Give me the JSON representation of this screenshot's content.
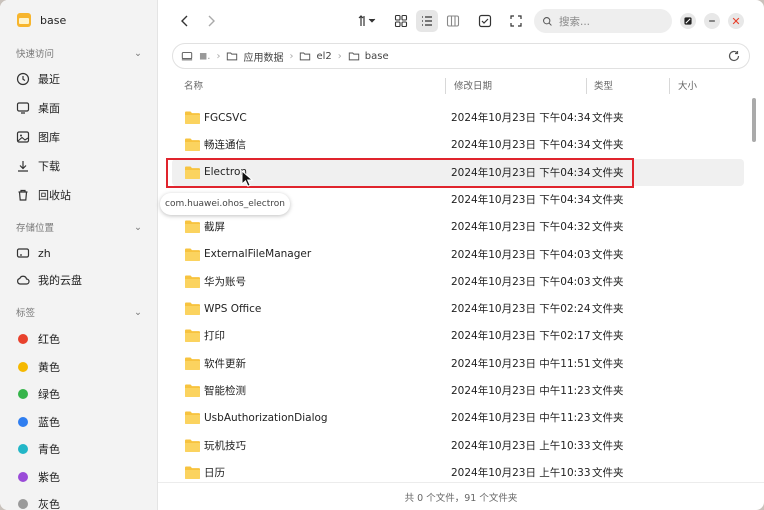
{
  "app": {
    "title": "base"
  },
  "sidebar": {
    "quick_access": {
      "header": "快速访问",
      "items": [
        {
          "label": "最近",
          "icon": "clock-icon"
        },
        {
          "label": "桌面",
          "icon": "desktop-icon"
        },
        {
          "label": "图库",
          "icon": "gallery-icon"
        },
        {
          "label": "下载",
          "icon": "download-icon"
        },
        {
          "label": "回收站",
          "icon": "trash-icon"
        }
      ]
    },
    "storage": {
      "header": "存储位置",
      "items": [
        {
          "label": "zh",
          "icon": "drive-icon"
        },
        {
          "label": "我的云盘",
          "icon": "cloud-icon"
        }
      ]
    },
    "tags": {
      "header": "标签",
      "items": [
        {
          "label": "红色",
          "color": "#e8412c"
        },
        {
          "label": "黄色",
          "color": "#f5b800"
        },
        {
          "label": "绿色",
          "color": "#35b44a"
        },
        {
          "label": "蓝色",
          "color": "#2f7ef0"
        },
        {
          "label": "青色",
          "color": "#22b6c7"
        },
        {
          "label": "紫色",
          "color": "#9a4bd8"
        },
        {
          "label": "灰色",
          "color": "#9a9a9a"
        }
      ]
    }
  },
  "toolbar": {
    "search_placeholder": "搜索..."
  },
  "address": {
    "crumbs": [
      "应用数据",
      "el2",
      "base"
    ]
  },
  "columns": {
    "name": "名称",
    "date": "修改日期",
    "type": "类型",
    "size": "大小"
  },
  "files": [
    {
      "name": "FGCSVC",
      "date": "2024年10月23日 下午04:34",
      "type": "文件夹"
    },
    {
      "name": "畅连通信",
      "date": "2024年10月23日 下午04:34",
      "type": "文件夹"
    },
    {
      "name": "Electron",
      "date": "2024年10月23日 下午04:34",
      "type": "文件夹"
    },
    {
      "name": "",
      "date": "2024年10月23日 下午04:34",
      "type": "文件夹"
    },
    {
      "name": "截屏",
      "date": "2024年10月23日 下午04:32",
      "type": "文件夹"
    },
    {
      "name": "ExternalFileManager",
      "date": "2024年10月23日 下午04:03",
      "type": "文件夹"
    },
    {
      "name": "华为账号",
      "date": "2024年10月23日 下午04:03",
      "type": "文件夹"
    },
    {
      "name": "WPS Office",
      "date": "2024年10月23日 下午02:24",
      "type": "文件夹"
    },
    {
      "name": "打印",
      "date": "2024年10月23日 下午02:17",
      "type": "文件夹"
    },
    {
      "name": "软件更新",
      "date": "2024年10月23日 中午11:51",
      "type": "文件夹"
    },
    {
      "name": "智能检测",
      "date": "2024年10月23日 中午11:23",
      "type": "文件夹"
    },
    {
      "name": "UsbAuthorizationDialog",
      "date": "2024年10月23日 中午11:23",
      "type": "文件夹"
    },
    {
      "name": "玩机技巧",
      "date": "2024年10月23日 上午10:33",
      "type": "文件夹"
    },
    {
      "name": "日历",
      "date": "2024年10月23日 上午10:33",
      "type": "文件夹"
    }
  ],
  "tooltip": "com.huawei.ohos_electron",
  "status": "共 0 个文件，91 个文件夹",
  "colors": {
    "folder": "#f7c33f",
    "highlight": "#e0242d",
    "close": "#e8412c"
  }
}
